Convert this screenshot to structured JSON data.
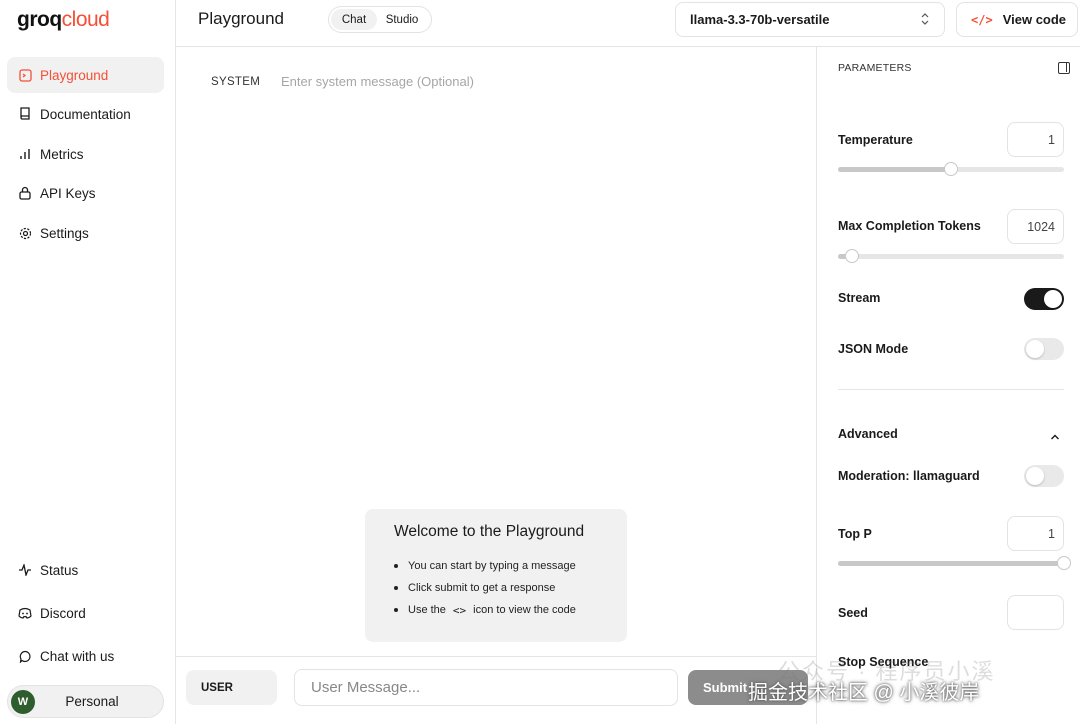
{
  "sidebar": {
    "logo": {
      "groq": "groq",
      "cloud": "cloud"
    },
    "nav": [
      {
        "label": "Playground",
        "icon": "playground-icon"
      },
      {
        "label": "Documentation",
        "icon": "book-icon"
      },
      {
        "label": "Metrics",
        "icon": "bar-chart-icon"
      },
      {
        "label": "API Keys",
        "icon": "lock-icon"
      },
      {
        "label": "Settings",
        "icon": "gear-icon"
      }
    ],
    "bottom_nav": [
      {
        "label": "Status",
        "icon": "activity-icon"
      },
      {
        "label": "Discord",
        "icon": "discord-icon"
      },
      {
        "label": "Chat with us",
        "icon": "chat-bubble-icon"
      }
    ],
    "account": {
      "avatar": "W",
      "label": "Personal"
    }
  },
  "header": {
    "title": "Playground",
    "tabs": [
      "Chat",
      "Studio"
    ],
    "model": "llama-3.3-70b-versatile",
    "view_code": "View code"
  },
  "main": {
    "system_label": "SYSTEM",
    "system_placeholder": "Enter system message (Optional)",
    "welcome": {
      "title": "Welcome to the Playground",
      "items": [
        "You can start by typing a message",
        "Click submit to get a response"
      ],
      "code_item_before": "Use the",
      "code_item_after": "icon to view the code"
    },
    "user_role": "USER",
    "user_placeholder": "User Message...",
    "submit": "Submit"
  },
  "params": {
    "title": "PARAMETERS",
    "temperature": {
      "label": "Temperature",
      "value": "1",
      "fraction": 0.5
    },
    "max_tokens": {
      "label": "Max Completion Tokens",
      "value": "1024",
      "fraction": 0.06
    },
    "stream": {
      "label": "Stream",
      "on": true
    },
    "json_mode": {
      "label": "JSON Mode",
      "on": false
    },
    "advanced": "Advanced",
    "moderation": {
      "label": "Moderation: llamaguard",
      "on": false
    },
    "top_p": {
      "label": "Top P",
      "value": "1",
      "fraction": 1.0
    },
    "seed": {
      "label": "Seed"
    },
    "stop_sequence": {
      "label": "Stop Sequence"
    }
  },
  "watermark": {
    "text": "掘金技术社区 @ 小溪彼岸",
    "faint": "公众号 · 程序员小溪"
  },
  "colors": {
    "accent": "#f55036",
    "toggle_on": "#1a1a1a",
    "submit_bg": "#8c8c8c"
  }
}
